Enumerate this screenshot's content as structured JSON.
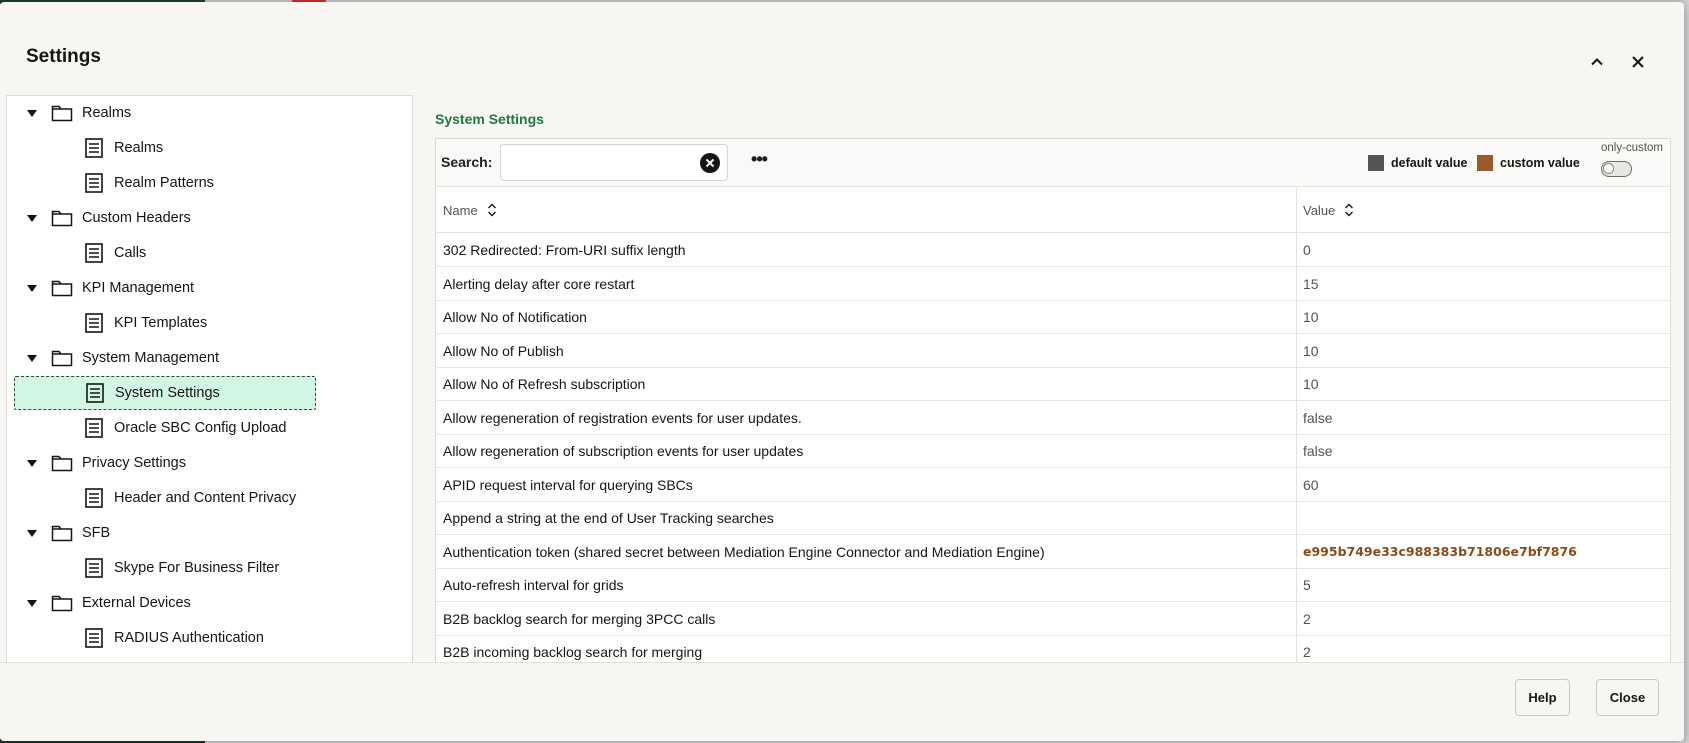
{
  "dialog": {
    "title": "Settings",
    "collapse_icon": "chevron-up-icon",
    "close_icon": "close-icon"
  },
  "tree": {
    "nodes": [
      {
        "label": "Realms",
        "kind": "folder",
        "level": 0
      },
      {
        "label": "Realms",
        "kind": "page",
        "level": 1
      },
      {
        "label": "Realm Patterns",
        "kind": "page",
        "level": 1
      },
      {
        "label": "Custom Headers",
        "kind": "folder",
        "level": 0
      },
      {
        "label": "Calls",
        "kind": "page",
        "level": 1
      },
      {
        "label": "KPI Management",
        "kind": "folder",
        "level": 0
      },
      {
        "label": "KPI Templates",
        "kind": "page",
        "level": 1
      },
      {
        "label": "System Management",
        "kind": "folder",
        "level": 0
      },
      {
        "label": "System Settings",
        "kind": "page",
        "level": 1,
        "selected": true
      },
      {
        "label": "Oracle SBC Config Upload",
        "kind": "page",
        "level": 1
      },
      {
        "label": "Privacy Settings",
        "kind": "folder",
        "level": 0
      },
      {
        "label": "Header and Content Privacy",
        "kind": "page",
        "level": 1
      },
      {
        "label": "SFB",
        "kind": "folder",
        "level": 0
      },
      {
        "label": "Skype For Business Filter",
        "kind": "page",
        "level": 1
      },
      {
        "label": "External Devices",
        "kind": "folder",
        "level": 0
      },
      {
        "label": "RADIUS Authentication",
        "kind": "page",
        "level": 1
      }
    ]
  },
  "panel": {
    "title": "System Settings",
    "search_label": "Search:",
    "search_value": "",
    "search_placeholder": "",
    "more_label": "•••",
    "legend": {
      "default_label": "default value",
      "default_color": "#545454",
      "custom_label": "custom value",
      "custom_color": "#9a5a2e"
    },
    "only_custom_label": "only-custom",
    "only_custom_on": false
  },
  "table": {
    "columns": [
      "Name",
      "Value"
    ],
    "rows": [
      {
        "name": "302 Redirected: From-URI suffix length",
        "value": "0",
        "custom": false
      },
      {
        "name": "Alerting delay after core restart",
        "value": "15",
        "custom": false
      },
      {
        "name": "Allow No of Notification",
        "value": "10",
        "custom": false
      },
      {
        "name": "Allow No of Publish",
        "value": "10",
        "custom": false
      },
      {
        "name": "Allow No of Refresh subscription",
        "value": "10",
        "custom": false
      },
      {
        "name": "Allow regeneration of registration events for user updates.",
        "value": "false",
        "custom": false
      },
      {
        "name": "Allow regeneration of subscription events for user updates",
        "value": "false",
        "custom": false
      },
      {
        "name": "APID request interval for querying SBCs",
        "value": "60",
        "custom": false
      },
      {
        "name": "Append a string at the end of User Tracking searches",
        "value": "",
        "custom": false
      },
      {
        "name": "Authentication token (shared secret between Mediation Engine Connector and Mediation Engine)",
        "value": "e995b749e33c988383b71806e7bf7876",
        "custom": true
      },
      {
        "name": "Auto-refresh interval for grids",
        "value": "5",
        "custom": false
      },
      {
        "name": "B2B backlog search for merging 3PCC calls",
        "value": "2",
        "custom": false
      },
      {
        "name": "B2B incoming backlog search for merging",
        "value": "2",
        "custom": false
      }
    ]
  },
  "footer": {
    "help_label": "Help",
    "close_label": "Close"
  }
}
